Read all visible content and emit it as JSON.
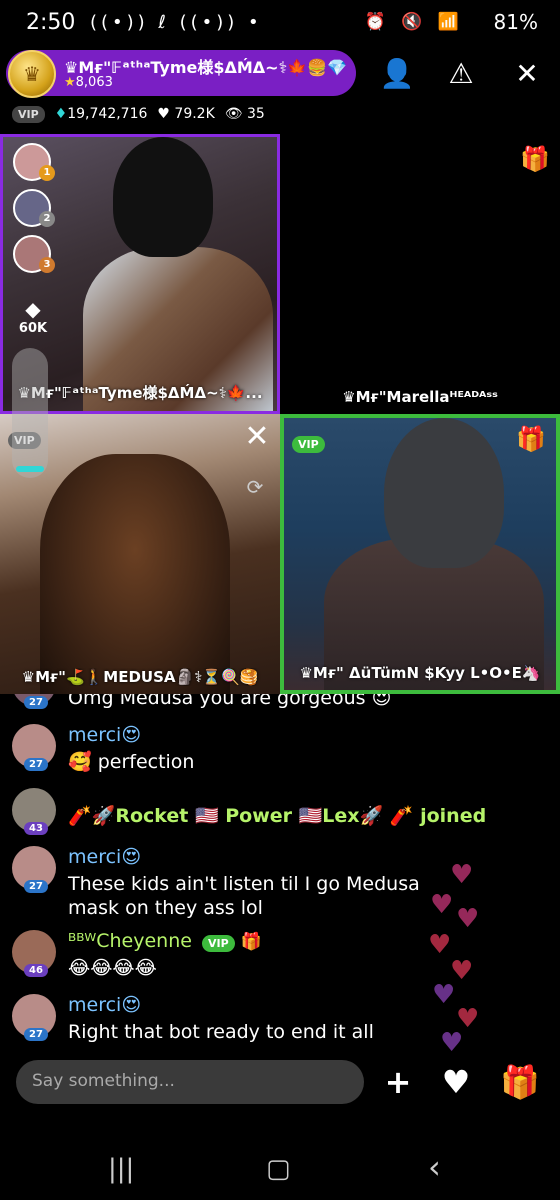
{
  "status_bar": {
    "time": "2:50",
    "left_icons": "((•)) ℓ ((•)) •",
    "right_icons": "⏰ 🔇 📶",
    "battery": "81%"
  },
  "host": {
    "name": "♛Mғ\"𝔽ᵃᵗʰᵃTyme様$ΔḾΔ~⚕🍁🍔💎♾...",
    "stars": "8,063",
    "vip": "VIP",
    "diamonds": "19,742,716",
    "likes": "79.2K",
    "viewers": "35"
  },
  "header_icons": {
    "follow": "👤",
    "report": "⚠",
    "close": "✕"
  },
  "tiles": [
    {
      "label": "♛Mғ\"𝔽ᵃᵗʰᵃTyme様$ΔḾΔ~⚕🍁...",
      "side_value": "60K",
      "ranks": [
        "1",
        "2",
        "3"
      ]
    },
    {
      "label": "♛Mғ\"Marellaᴴᴱᴬᴰᴬˢˢ"
    },
    {
      "label": "♛Mғ\"⛳🚶MEDUSA🗿⚕⏳🍭🥞",
      "vip": "VIP"
    },
    {
      "label": "♛Mғ\" ΔüTümN $Kyy L•O•E🦄",
      "vip": "VIP"
    }
  ],
  "chat": {
    "partial_text": "Omg Medusa you are gorgeous 😍",
    "partial_level": "27",
    "messages": [
      {
        "name": "merci😍",
        "level": "27",
        "text": "🥰 perfection"
      },
      {
        "name": "merci😍",
        "level": "27",
        "text": "These kids ain't listen til I go Medusa mask on they ass lol"
      },
      {
        "name": "ᴮᴮᵂCheyenne",
        "level": "46",
        "text": "😂😂😂😂",
        "badge": "VIP"
      },
      {
        "name": "merci😍",
        "level": "27",
        "text": "Right that bot ready to end it all"
      }
    ],
    "joined": {
      "level": "43",
      "text": "🧨🚀Rocket 🇺🇸 Power 🇺🇸Lex🚀 🧨  joined"
    }
  },
  "input": {
    "placeholder": "Say something..."
  },
  "bottom_icons": {
    "add": "+",
    "like": "♥",
    "gift": "🎁"
  },
  "nav": {
    "recents": "|||",
    "home": "▢",
    "back": "‹"
  },
  "colors": {
    "accent_purple": "#7a1fc4",
    "active_tile_green": "#3dbb3d",
    "username_blue": "#7cc3ff",
    "joined_green": "#b6f36a"
  }
}
